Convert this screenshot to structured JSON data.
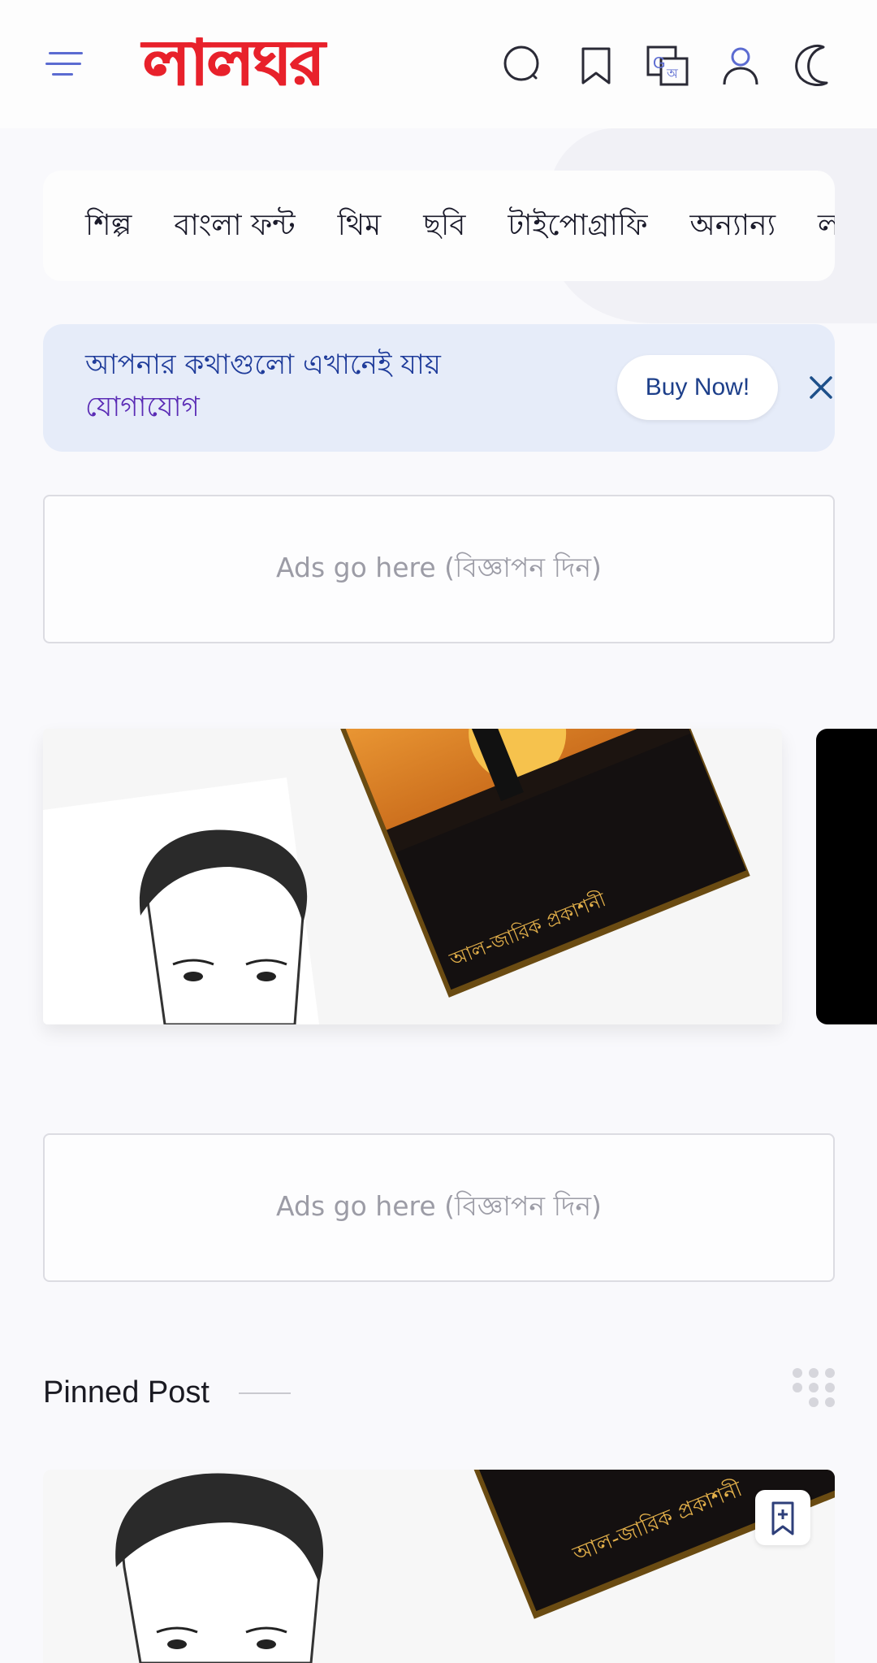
{
  "site": {
    "logo_text": "লালঘর"
  },
  "header": {
    "icons": [
      "menu-icon",
      "search-icon",
      "bookmark-icon",
      "translate-icon",
      "user-icon",
      "moon-icon"
    ]
  },
  "categories": [
    "শিল্প",
    "বাংলা ফন্ট",
    "থিম",
    "ছবি",
    "টাইপোগ্রাফি",
    "অন্যান্য",
    "ল"
  ],
  "promo": {
    "line1": "আপনার কথাগুলো এখানেই যায়",
    "line2": "যোগাযোগ",
    "button_label": "Buy Now!"
  },
  "ads": {
    "label_top": "Ads go here (বিজ্ঞাপন দিন)",
    "label_bottom": "Ads go here (বিজ্ঞাপন দিন)"
  },
  "slider": {
    "book_publisher": "আল-জারিক প্রকাশনী"
  },
  "pinned": {
    "title": "Pinned Post",
    "book_publisher": "আল-জারিক প্রকাশনী"
  },
  "colors": {
    "brand_red": "#e8212b",
    "accent_blue": "#5b6bd1",
    "promo_bg": "#e6ecf9"
  }
}
